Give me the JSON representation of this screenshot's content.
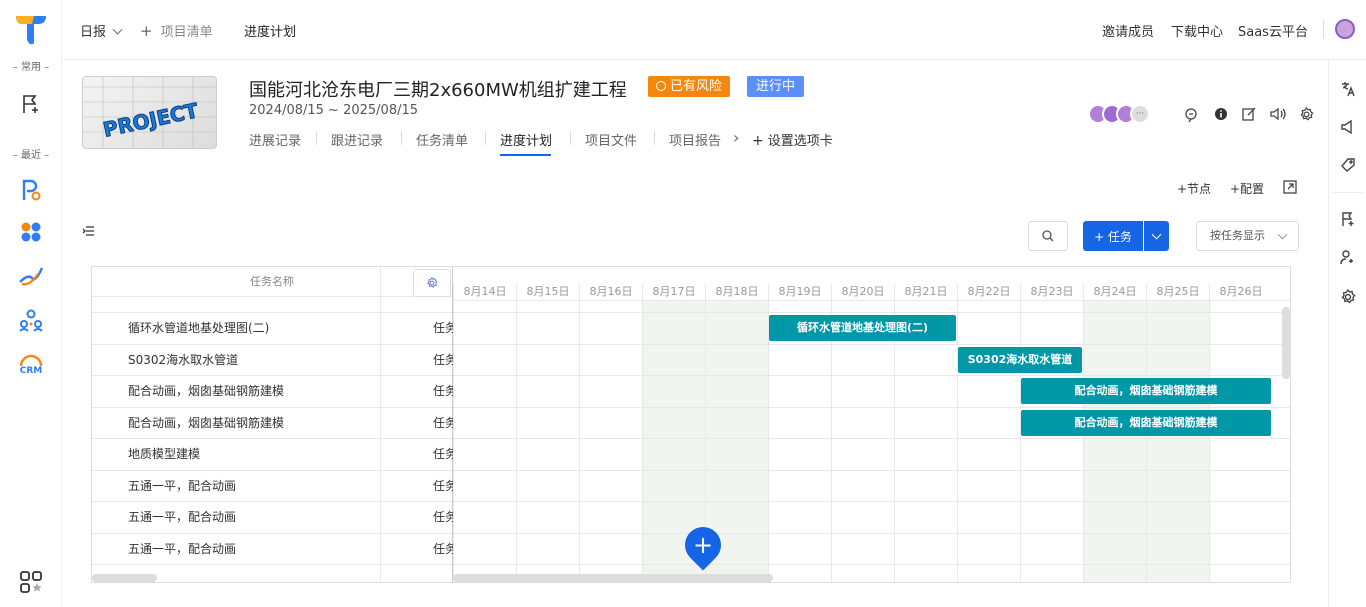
{
  "sidebar": {
    "section_common": "– 常用 –",
    "section_recent": "– 最近 –",
    "crm_label": "CRM"
  },
  "topnav": {
    "daily": "日报",
    "add_symbol": "+",
    "project_list": "项目清单",
    "schedule": "进度计划",
    "invite": "邀请成员",
    "download": "下载中心",
    "saas": "Saas云平台"
  },
  "project": {
    "logo_text": "PROJECT",
    "title": "国能河北沧东电厂三期2x660MW机组扩建工程",
    "risk_badge": "已有风险",
    "status_badge": "进行中",
    "date_range": "2024/08/15 ~ 2025/08/15",
    "avatar_more": "···",
    "tabs": [
      "进展记录",
      "跟进记录",
      "任务清单",
      "进度计划",
      "项目文件",
      "项目报告"
    ],
    "tab_more": "›",
    "tab_settings": "设置选项卡"
  },
  "toolbar": {
    "add_node": "+节点",
    "config": "+配置",
    "task_button": "+ 任务",
    "display_select": "按任务显示"
  },
  "gantt": {
    "col_task_name": "任务名称",
    "dates": [
      "8月14日",
      "8月15日",
      "8月16日",
      "8月17日",
      "8月18日",
      "8月19日",
      "8月20日",
      "8月21日",
      "8月22日",
      "8月23日",
      "8月24日",
      "8月25日",
      "8月26日"
    ],
    "rows": [
      {
        "name": "循环水管道地基处理图(二)",
        "type": "任务"
      },
      {
        "name": "S0302海水取水管道",
        "type": "任务"
      },
      {
        "name": "配合动画，烟囱基础钢筋建模",
        "type": "任务"
      },
      {
        "name": "配合动画，烟囱基础钢筋建模",
        "type": "任务"
      },
      {
        "name": "地质模型建模",
        "type": "任务"
      },
      {
        "name": "五通一平，配合动画",
        "type": "任务"
      },
      {
        "name": "五通一平，配合动画",
        "type": "任务"
      },
      {
        "name": "五通一平，配合动画",
        "type": "任务"
      }
    ],
    "bars": [
      {
        "label": "循环水管道地基处理图(二)",
        "row": 0,
        "start": "8月19日",
        "end": "8月21日"
      },
      {
        "label": "S0302海水取水管道",
        "row": 1,
        "start": "8月22日",
        "end": "8月23日"
      },
      {
        "label": "配合动画，烟囱基础钢筋建模",
        "row": 2,
        "start": "8月23日",
        "end": "8月26日"
      },
      {
        "label": "配合动画，烟囱基础钢筋建模",
        "row": 3,
        "start": "8月23日",
        "end": "8月26日"
      }
    ],
    "bar_color": "#0097a7",
    "weekend_color": "#f0f5f0"
  },
  "colors": {
    "risk": "#f5870f",
    "status": "#5b8ff9",
    "primary": "#1565e6"
  }
}
